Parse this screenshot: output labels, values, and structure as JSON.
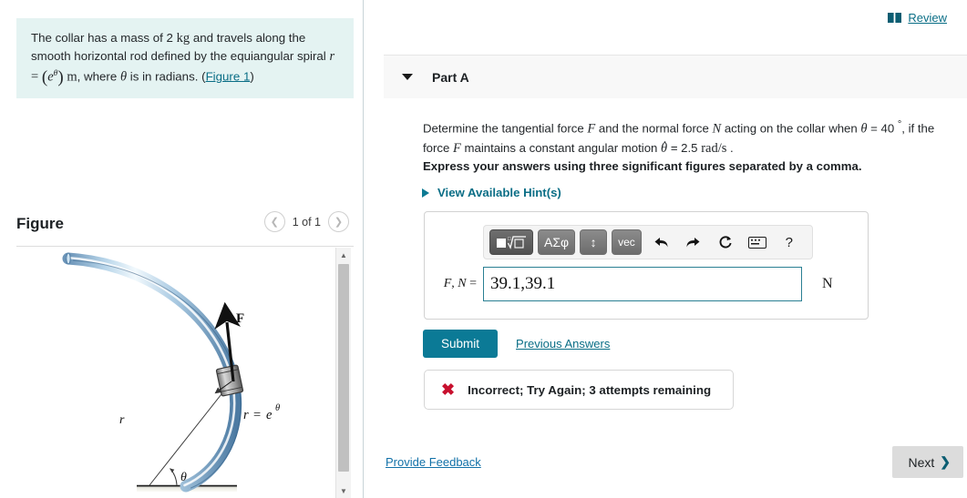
{
  "problem": {
    "line1_a": "The collar has a mass of 2 ",
    "line1_kg": "kg",
    "line1_b": " and travels along the smooth horizontal rod defined by the equiangular spiral ",
    "eq_r": "r",
    "eq_equals": "=",
    "eq_e": "e",
    "eq_theta": "θ",
    "eq_unit": "m",
    "line2_tail": ", where ",
    "theta_sym": "θ",
    "line2_end": " is in radians. ",
    "figure_link": "Figure 1"
  },
  "figure": {
    "title": "Figure",
    "pager_label": "1 of 1",
    "prev_icon": "chevron-left-icon",
    "next_icon": "chevron-right-icon",
    "labels": {
      "force": "F",
      "radius": "r",
      "angle": "θ",
      "curve_eq_r": "r",
      "curve_eq_equals": "=",
      "curve_eq_e": "e",
      "curve_eq_theta": "θ"
    },
    "colors": {
      "rod_light": "#eaf4fb",
      "rod_mid": "#9fc4e0",
      "rod_dark": "#5a87ae",
      "collar": "#9a9a9a"
    }
  },
  "header": {
    "review_label": "Review",
    "review_icon": "book-icon"
  },
  "part": {
    "title": "Part A",
    "caret_icon": "caret-down-icon",
    "question_a": "Determine the tangential force ",
    "question_F": "F",
    "question_b": " and the normal force ",
    "question_N": "N",
    "question_c": " acting on the collar when ",
    "question_theta": "θ",
    "question_d": " = 40 ",
    "question_deg": "°",
    "question_e": ", if the force ",
    "question_F2": "F",
    "question_f": " maintains a constant angular motion ",
    "question_thetadot": "θ",
    "question_g": " = 2.5 ",
    "question_rads": "rad/s",
    "question_h": " .",
    "instruction": "Express your answers using three significant figures separated by a comma.",
    "hints_label": "View Available Hint(s)",
    "hints_icon": "triangle-right-icon"
  },
  "answer": {
    "toolbar": [
      {
        "name": "template-sqrt-button",
        "label": "■√□",
        "style": "active"
      },
      {
        "name": "greek-letters-button",
        "label": "ΑΣφ",
        "style": "normal"
      },
      {
        "name": "updown-arrows-button",
        "label": "↕",
        "style": "normal"
      },
      {
        "name": "vector-button",
        "label": "vec",
        "style": "normal"
      },
      {
        "name": "undo-button",
        "label": "↶",
        "style": "plain"
      },
      {
        "name": "redo-button",
        "label": "↷",
        "style": "plain"
      },
      {
        "name": "reset-button",
        "label": "↻",
        "style": "plain"
      },
      {
        "name": "keyboard-button",
        "label": "keyboard-icon",
        "style": "plain"
      },
      {
        "name": "help-button",
        "label": "?",
        "style": "plain"
      }
    ],
    "label_F": "F",
    "label_comma": ", ",
    "label_N": "N",
    "label_equals": " =",
    "value": "39.1,39.1",
    "placeholder": "",
    "unit": "N"
  },
  "actions": {
    "submit_label": "Submit",
    "previous_answers_label": "Previous Answers"
  },
  "feedback": {
    "icon": "x-mark-icon",
    "text": "Incorrect; Try Again; 3 attempts remaining"
  },
  "footer": {
    "provide_feedback_label": "Provide Feedback",
    "next_label": "Next",
    "next_icon": "chevron-right-icon"
  },
  "colors": {
    "accent_teal": "#0b7a96",
    "link_teal": "#0a6e86",
    "problem_bg": "#e4f3f2",
    "error_red": "#c8102e"
  }
}
